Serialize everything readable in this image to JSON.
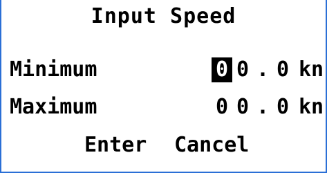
{
  "dialog": {
    "title": "Input Speed"
  },
  "rows": [
    {
      "label": "Minimum",
      "digits": [
        "0",
        "0"
      ],
      "separator": ".",
      "decimal": "0",
      "unit": "kn"
    },
    {
      "label": "Maximum",
      "digits": [
        "0",
        "0"
      ],
      "separator": ".",
      "decimal": "0",
      "unit": "kn"
    }
  ],
  "actions": {
    "enter_label": "Enter",
    "cancel_label": "Cancel"
  },
  "colors": {
    "border": "#2a6fd6",
    "cursor_bg": "#000000",
    "text": "#000000"
  }
}
